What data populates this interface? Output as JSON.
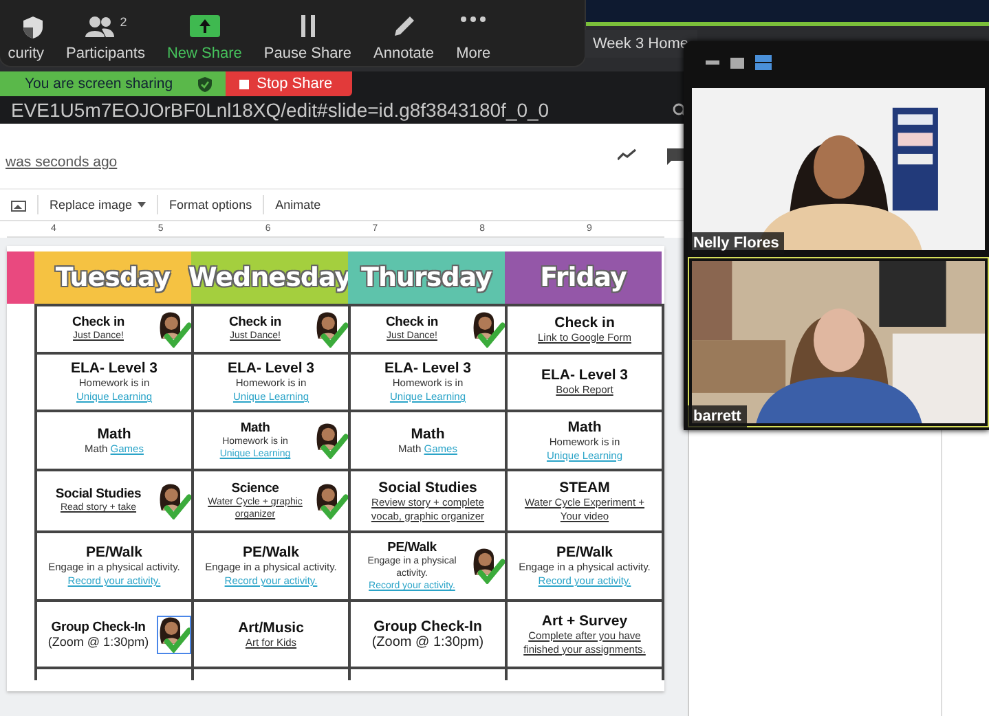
{
  "zoom_toolbar": {
    "items": [
      {
        "kind": "security",
        "label": "curity"
      },
      {
        "kind": "participants",
        "label": "Participants",
        "count": "2"
      },
      {
        "kind": "new-share",
        "label": "New Share"
      },
      {
        "kind": "pause",
        "label": "Pause Share"
      },
      {
        "kind": "annotate",
        "label": "Annotate"
      },
      {
        "kind": "more",
        "label": "More"
      }
    ]
  },
  "browser": {
    "tab_title": "Week 3 Home",
    "url": "EVE1U5m7EOJOrBF0Lnl18XQ/edit#slide=id.g8f3843180f_0_0"
  },
  "sharing_banner": {
    "status": "You are screen sharing",
    "stop_button": "Stop Share"
  },
  "slides": {
    "last_edit": "was seconds ago",
    "toolbar": [
      "Replace image",
      "Format options",
      "Animate"
    ],
    "ruler": [
      "4",
      "5",
      "6",
      "7",
      "8",
      "9"
    ]
  },
  "schedule": {
    "days": [
      {
        "color": "#e9497f"
      },
      {
        "name": "Tuesday",
        "color": "#f5c242"
      },
      {
        "name": "Wednesday",
        "color": "#a4cf3e"
      },
      {
        "name": "Thursday",
        "color": "#5ec3ab"
      },
      {
        "name": "Friday",
        "color": "#9457a8"
      }
    ],
    "rows": [
      {
        "cells": [
          {
            "title": "Check in",
            "link": "Just Dance!",
            "done": true,
            "selected": false
          },
          {
            "title": "Check in",
            "link": "Just Dance!",
            "done": true,
            "selected": false
          },
          {
            "title": "Check in",
            "link": "Just Dance!",
            "done": true,
            "selected": false
          },
          {
            "title": "Check in",
            "link": "Link to Google Form",
            "done": false,
            "selected": false
          }
        ]
      },
      {
        "cells": [
          {
            "title": "ELA- Level 3",
            "note": "Homework is in",
            "link": "Unique Learning",
            "done": false,
            "selected": false
          },
          {
            "title": "ELA- Level 3",
            "note": "Homework is in",
            "link": "Unique Learning",
            "done": false,
            "selected": false
          },
          {
            "title": "ELA- Level 3",
            "note": "Homework is in",
            "link": "Unique Learning",
            "done": false,
            "selected": false
          },
          {
            "title": "ELA- Level 3",
            "link": "Book Report",
            "done": false,
            "selected": false
          }
        ]
      },
      {
        "cells": [
          {
            "title": "Math",
            "note": "Math",
            "link": "Games",
            "done": false,
            "selected": false
          },
          {
            "title": "Math",
            "note": "Homework is in",
            "link": "Unique Learning",
            "done": true,
            "selected": false
          },
          {
            "title": "Math",
            "note": "Math",
            "link": "Games",
            "done": false,
            "selected": false
          },
          {
            "title": "Math",
            "note": "Homework is in",
            "link": "Unique Learning",
            "done": false,
            "selected": false
          }
        ]
      },
      {
        "cells": [
          {
            "title": "Social Studies",
            "link": "Read story + take",
            "done": true,
            "selected": false
          },
          {
            "title": "Science",
            "link": "Water Cycle + graphic organizer",
            "done": true,
            "selected": false
          },
          {
            "title": "Social Studies",
            "link": "Review story + complete vocab, graphic organizer",
            "done": false,
            "selected": false
          },
          {
            "title": "STEAM",
            "link": "Water Cycle Experiment + Your video",
            "done": false,
            "selected": false
          }
        ]
      },
      {
        "cells": [
          {
            "title": "PE/Walk",
            "note": "Engage in a physical activity.",
            "link": "Record your activity.",
            "done": false,
            "selected": false
          },
          {
            "title": "PE/Walk",
            "note": "Engage in a physical activity.",
            "link": "Record your activity.",
            "done": false,
            "selected": false
          },
          {
            "title": "PE/Walk",
            "note": "Engage in a physical activity.",
            "link": "Record your activity.",
            "done": true,
            "selected": false
          },
          {
            "title": "PE/Walk",
            "note": "Engage in a physical activity.",
            "link": "Record your activity.",
            "done": false,
            "selected": false
          }
        ]
      },
      {
        "cells": [
          {
            "title": "Group Check-In",
            "subtitle": "(Zoom @ 1:30pm)",
            "done": true,
            "selected": true
          },
          {
            "title": "Art/Music",
            "link": "Art for Kids",
            "done": false,
            "selected": false
          },
          {
            "title": "Group Check-In",
            "subtitle": "(Zoom @ 1:30pm)",
            "done": false,
            "selected": false
          },
          {
            "title": "Art + Survey",
            "link": "Complete after you have finished your assignments.",
            "done": false,
            "selected": false
          }
        ]
      }
    ]
  },
  "video_panel": {
    "participants": [
      {
        "name": "Nelly Flores",
        "speaking": false,
        "kind": "picture"
      },
      {
        "name": "barrett",
        "speaking": true,
        "kind": "picture"
      }
    ]
  }
}
